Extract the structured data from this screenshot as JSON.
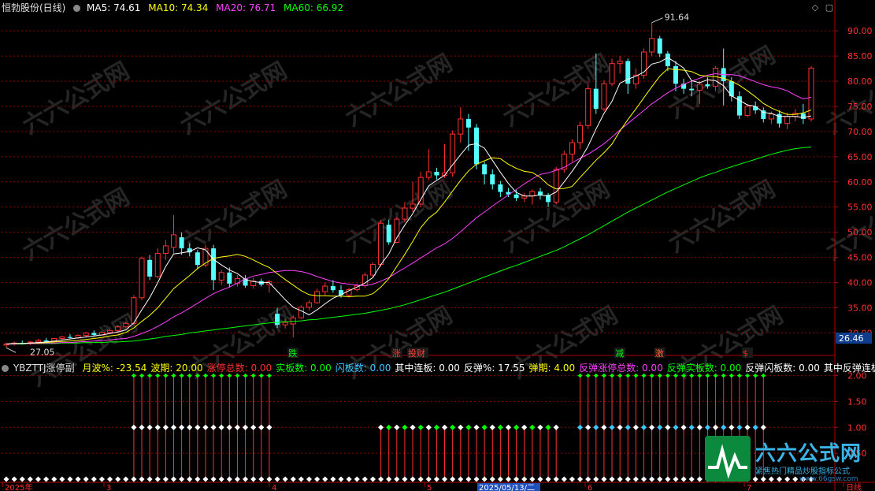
{
  "header": {
    "title": "恒勃股份(日线)",
    "ma5": "MA5: 74.61",
    "ma10": "MA10: 74.34",
    "ma20": "MA20: 76.71",
    "ma60": "MA60: 66.92"
  },
  "sub_header": {
    "name": "YBZTTJ涨停副",
    "items": [
      {
        "text": "月波%: -23.54",
        "color": "#ffff00"
      },
      {
        "text": "波期: 20.00",
        "color": "#ffff00"
      },
      {
        "text": "涨停总数: 0.00",
        "color": "#ff3030"
      },
      {
        "text": "实板数: 0.00",
        "color": "#00ff00"
      },
      {
        "text": "闪板数: 0.00",
        "color": "#3cc8ff"
      },
      {
        "text": "其中连板: 0.00",
        "color": "#ffffff"
      },
      {
        "text": "反弹%: 17.55",
        "color": "#ffffff"
      },
      {
        "text": "弹期: 4.00",
        "color": "#ffff00"
      },
      {
        "text": "反弹涨停总数: 0.00",
        "color": "#ff40ff"
      },
      {
        "text": "反弹实板数: 0.00",
        "color": "#00ff00"
      },
      {
        "text": "反弹闪板数: 0.00",
        "color": "#ffffff"
      },
      {
        "text": "其中反弹连板",
        "color": "#ffffff"
      }
    ]
  },
  "price_axis": {
    "ticks": [
      "90.00",
      "85.00",
      "80.00",
      "75.00",
      "70.00",
      "65.00",
      "60.00",
      "55.00",
      "50.00",
      "45.00",
      "40.00",
      "35.00",
      "30.00"
    ],
    "current": "26.46"
  },
  "sub_axis": {
    "ticks": [
      "2.00",
      "1.50",
      "1.00",
      "0.50"
    ]
  },
  "date_axis": {
    "labels": [
      "2025年",
      "3",
      "4",
      "5",
      "2025/05/13/二",
      "6",
      "7",
      "日线"
    ]
  },
  "annotations": {
    "high": "91.64",
    "low": "27.05",
    "events": [
      {
        "text": "跌",
        "color": "#00ff00"
      },
      {
        "text": "涨",
        "color": "#ff3030"
      },
      {
        "text": "投财",
        "color": "#ff4040"
      },
      {
        "text": "减",
        "color": "#00ff00"
      },
      {
        "text": "激",
        "color": "#ff6030"
      },
      {
        "text": "$",
        "color": "#ff2020"
      }
    ]
  },
  "logo": {
    "name": "六六公式网",
    "tagline": "紧焦热门精品炒股指标公式",
    "url": "www.66gsw.com"
  },
  "watermark": "六六公式网",
  "colors": {
    "up": "#ff3030",
    "down": "#54ffff",
    "ma5": "#ffffff",
    "ma10": "#ffff00",
    "ma20": "#ff40ff",
    "ma60": "#00ff00",
    "grid": "#8b0000"
  },
  "chart_data": {
    "type": "candlestick",
    "title": "恒勃股份(日线)",
    "ylim": [
      26,
      93
    ],
    "candles": [
      {
        "o": 27.6,
        "h": 28.1,
        "l": 27.05,
        "c": 27.8
      },
      {
        "o": 27.8,
        "h": 28.3,
        "l": 27.5,
        "c": 28.0
      },
      {
        "o": 28.0,
        "h": 28.5,
        "l": 27.7,
        "c": 27.9
      },
      {
        "o": 27.9,
        "h": 28.4,
        "l": 27.6,
        "c": 28.2
      },
      {
        "o": 28.2,
        "h": 28.8,
        "l": 28.0,
        "c": 28.5
      },
      {
        "o": 28.5,
        "h": 29.0,
        "l": 28.2,
        "c": 28.3
      },
      {
        "o": 28.3,
        "h": 29.0,
        "l": 28.1,
        "c": 28.9
      },
      {
        "o": 28.9,
        "h": 29.4,
        "l": 28.5,
        "c": 29.2
      },
      {
        "o": 29.2,
        "h": 29.8,
        "l": 28.9,
        "c": 29.0
      },
      {
        "o": 29.0,
        "h": 29.7,
        "l": 28.8,
        "c": 29.5
      },
      {
        "o": 29.5,
        "h": 30.2,
        "l": 29.2,
        "c": 30.0
      },
      {
        "o": 30.0,
        "h": 30.5,
        "l": 29.3,
        "c": 29.6
      },
      {
        "o": 29.6,
        "h": 30.3,
        "l": 29.4,
        "c": 30.1
      },
      {
        "o": 30.1,
        "h": 30.8,
        "l": 29.8,
        "c": 30.5
      },
      {
        "o": 30.5,
        "h": 31.5,
        "l": 30.2,
        "c": 31.2
      },
      {
        "o": 31.2,
        "h": 32.2,
        "l": 30.9,
        "c": 31.9
      },
      {
        "o": 31.9,
        "h": 37.5,
        "l": 31.5,
        "c": 37.0
      },
      {
        "o": 37.0,
        "h": 45.2,
        "l": 36.5,
        "c": 44.8
      },
      {
        "o": 44.5,
        "h": 45.5,
        "l": 40.5,
        "c": 41.2
      },
      {
        "o": 41.2,
        "h": 46.8,
        "l": 40.8,
        "c": 45.8
      },
      {
        "o": 45.8,
        "h": 48.5,
        "l": 44.5,
        "c": 47.3
      },
      {
        "o": 47.0,
        "h": 53.4,
        "l": 45.8,
        "c": 49.5
      },
      {
        "o": 49.0,
        "h": 50.0,
        "l": 45.5,
        "c": 46.8
      },
      {
        "o": 46.8,
        "h": 47.8,
        "l": 45.2,
        "c": 46.0
      },
      {
        "o": 46.0,
        "h": 46.5,
        "l": 42.8,
        "c": 43.5
      },
      {
        "o": 43.5,
        "h": 47.5,
        "l": 43.0,
        "c": 46.8
      },
      {
        "o": 46.8,
        "h": 47.5,
        "l": 38.5,
        "c": 40.5
      },
      {
        "o": 40.5,
        "h": 42.5,
        "l": 39.5,
        "c": 42.0
      },
      {
        "o": 42.0,
        "h": 43.0,
        "l": 39.0,
        "c": 39.8
      },
      {
        "o": 39.8,
        "h": 41.5,
        "l": 39.2,
        "c": 40.8
      },
      {
        "o": 40.8,
        "h": 41.5,
        "l": 39.0,
        "c": 39.4
      },
      {
        "o": 39.4,
        "h": 41.0,
        "l": 38.8,
        "c": 40.3
      },
      {
        "o": 40.3,
        "h": 40.8,
        "l": 39.2,
        "c": 39.6
      },
      {
        "o": 39.6,
        "h": 40.5,
        "l": 38.0,
        "c": 40.2
      },
      {
        "o": 33.8,
        "h": 35.0,
        "l": 31.0,
        "c": 31.6
      },
      {
        "o": 31.6,
        "h": 32.8,
        "l": 30.9,
        "c": 32.1
      },
      {
        "o": 31.8,
        "h": 33.5,
        "l": 29.1,
        "c": 33.0
      },
      {
        "o": 33.0,
        "h": 35.5,
        "l": 32.8,
        "c": 35.1
      },
      {
        "o": 35.1,
        "h": 36.5,
        "l": 34.5,
        "c": 36.0
      },
      {
        "o": 36.0,
        "h": 38.8,
        "l": 35.8,
        "c": 38.2
      },
      {
        "o": 38.2,
        "h": 40.0,
        "l": 37.5,
        "c": 39.3
      },
      {
        "o": 39.3,
        "h": 40.5,
        "l": 38.0,
        "c": 38.5
      },
      {
        "o": 38.5,
        "h": 39.5,
        "l": 37.0,
        "c": 37.5
      },
      {
        "o": 37.5,
        "h": 39.0,
        "l": 37.0,
        "c": 38.6
      },
      {
        "o": 38.6,
        "h": 39.8,
        "l": 38.2,
        "c": 39.4
      },
      {
        "o": 39.4,
        "h": 42.0,
        "l": 39.0,
        "c": 41.5
      },
      {
        "o": 41.5,
        "h": 44.0,
        "l": 41.0,
        "c": 43.6
      },
      {
        "o": 43.6,
        "h": 52.4,
        "l": 43.2,
        "c": 51.8
      },
      {
        "o": 51.5,
        "h": 52.5,
        "l": 47.5,
        "c": 48.0
      },
      {
        "o": 48.0,
        "h": 53.0,
        "l": 47.8,
        "c": 52.6
      },
      {
        "o": 52.6,
        "h": 56.0,
        "l": 52.0,
        "c": 54.8
      },
      {
        "o": 54.8,
        "h": 60.0,
        "l": 54.0,
        "c": 55.6
      },
      {
        "o": 55.6,
        "h": 62.0,
        "l": 55.0,
        "c": 60.9
      },
      {
        "o": 60.9,
        "h": 66.5,
        "l": 60.3,
        "c": 62.0
      },
      {
        "o": 62.0,
        "h": 62.8,
        "l": 60.5,
        "c": 61.3
      },
      {
        "o": 61.3,
        "h": 67.5,
        "l": 60.8,
        "c": 61.8
      },
      {
        "o": 61.8,
        "h": 70.2,
        "l": 61.0,
        "c": 69.5
      },
      {
        "o": 69.5,
        "h": 74.8,
        "l": 67.8,
        "c": 72.5
      },
      {
        "o": 72.5,
        "h": 73.5,
        "l": 66.2,
        "c": 70.8
      },
      {
        "o": 70.8,
        "h": 71.5,
        "l": 62.5,
        "c": 63.5
      },
      {
        "o": 63.5,
        "h": 64.0,
        "l": 59.5,
        "c": 61.5
      },
      {
        "o": 61.5,
        "h": 62.5,
        "l": 58.5,
        "c": 59.5
      },
      {
        "o": 59.5,
        "h": 60.2,
        "l": 57.0,
        "c": 58.0
      },
      {
        "o": 58.0,
        "h": 58.8,
        "l": 57.0,
        "c": 57.5
      },
      {
        "o": 57.5,
        "h": 58.5,
        "l": 56.2,
        "c": 56.8
      },
      {
        "o": 56.8,
        "h": 57.8,
        "l": 56.0,
        "c": 57.2
      },
      {
        "o": 57.2,
        "h": 58.5,
        "l": 55.5,
        "c": 58.1
      },
      {
        "o": 58.1,
        "h": 58.8,
        "l": 56.5,
        "c": 57.4
      },
      {
        "o": 57.4,
        "h": 57.8,
        "l": 55.0,
        "c": 56.0
      },
      {
        "o": 56.0,
        "h": 63.0,
        "l": 55.5,
        "c": 62.5
      },
      {
        "o": 62.5,
        "h": 66.2,
        "l": 61.8,
        "c": 65.5
      },
      {
        "o": 65.5,
        "h": 68.5,
        "l": 64.0,
        "c": 67.8
      },
      {
        "o": 67.8,
        "h": 72.0,
        "l": 66.5,
        "c": 71.2
      },
      {
        "o": 71.2,
        "h": 79.5,
        "l": 70.5,
        "c": 78.5
      },
      {
        "o": 78.5,
        "h": 85.5,
        "l": 73.5,
        "c": 74.5
      },
      {
        "o": 74.5,
        "h": 80.2,
        "l": 74.0,
        "c": 79.5
      },
      {
        "o": 79.5,
        "h": 84.5,
        "l": 79.0,
        "c": 83.5
      },
      {
        "o": 83.5,
        "h": 85.0,
        "l": 81.5,
        "c": 84.0
      },
      {
        "o": 84.0,
        "h": 84.5,
        "l": 77.5,
        "c": 79.5
      },
      {
        "o": 79.5,
        "h": 82.5,
        "l": 78.5,
        "c": 81.2
      },
      {
        "o": 81.2,
        "h": 86.5,
        "l": 80.5,
        "c": 85.8
      },
      {
        "o": 85.8,
        "h": 91.64,
        "l": 85.0,
        "c": 88.5
      },
      {
        "o": 88.5,
        "h": 89.0,
        "l": 84.8,
        "c": 85.5
      },
      {
        "o": 85.5,
        "h": 86.0,
        "l": 82.0,
        "c": 83.0
      },
      {
        "o": 83.0,
        "h": 84.0,
        "l": 78.0,
        "c": 79.5
      },
      {
        "o": 79.5,
        "h": 80.5,
        "l": 77.5,
        "c": 78.5
      },
      {
        "o": 78.5,
        "h": 80.0,
        "l": 77.0,
        "c": 78.2
      },
      {
        "o": 78.2,
        "h": 80.0,
        "l": 75.5,
        "c": 79.4
      },
      {
        "o": 79.4,
        "h": 80.8,
        "l": 78.5,
        "c": 79.0
      },
      {
        "o": 79.0,
        "h": 83.0,
        "l": 78.0,
        "c": 82.6
      },
      {
        "o": 82.6,
        "h": 86.5,
        "l": 75.2,
        "c": 80.0
      },
      {
        "o": 80.0,
        "h": 80.8,
        "l": 76.0,
        "c": 77.0
      },
      {
        "o": 77.0,
        "h": 78.0,
        "l": 72.5,
        "c": 73.2
      },
      {
        "o": 73.2,
        "h": 75.5,
        "l": 72.8,
        "c": 75.0
      },
      {
        "o": 75.0,
        "h": 76.0,
        "l": 73.5,
        "c": 74.2
      },
      {
        "o": 74.2,
        "h": 74.8,
        "l": 71.8,
        "c": 72.5
      },
      {
        "o": 72.5,
        "h": 74.0,
        "l": 71.5,
        "c": 73.5
      },
      {
        "o": 73.5,
        "h": 74.2,
        "l": 70.8,
        "c": 71.6
      },
      {
        "o": 71.6,
        "h": 73.8,
        "l": 70.5,
        "c": 73.0
      },
      {
        "o": 73.0,
        "h": 74.5,
        "l": 72.0,
        "c": 73.6
      },
      {
        "o": 73.6,
        "h": 75.5,
        "l": 71.5,
        "c": 72.5
      },
      {
        "o": 72.5,
        "h": 83.0,
        "l": 72.0,
        "c": 82.6
      }
    ],
    "ma5": [
      27.8,
      27.9,
      27.9,
      28.0,
      28.1,
      28.2,
      28.4,
      28.6,
      28.8,
      29.0,
      29.2,
      29.4,
      29.6,
      29.9,
      30.2,
      30.6,
      32.0,
      34.6,
      37.0,
      40.0,
      43.2,
      45.7,
      45.9,
      46.2,
      46.9,
      46.5,
      44.6,
      43.5,
      42.5,
      41.8,
      40.6,
      40.2,
      40.0,
      40.0,
      38.3,
      36.6,
      35.1,
      34.4,
      33.6,
      34.6,
      35.8,
      36.9,
      37.6,
      38.4,
      39.1,
      39.9,
      41.0,
      43.6,
      45.7,
      48.9,
      51.4,
      53.7,
      56.5,
      59.2,
      60.3,
      61.3,
      63.4,
      65.4,
      67.3,
      67.6,
      66.7,
      64.3,
      61.9,
      59.7,
      57.9,
      57.2,
      57.2,
      57.4,
      57.2,
      58.0,
      60.0,
      62.1,
      64.4,
      67.1,
      70.5,
      73.6,
      76.0,
      79.6,
      80.4,
      81.0,
      81.8,
      83.4,
      83.8,
      84.7,
      83.7,
      82.6,
      80.1,
      79.7,
      80.3,
      80.1,
      79.1,
      77.1,
      76.2,
      75.3,
      75.0,
      73.8,
      73.6,
      73.0,
      73.0,
      73.0,
      72.8,
      73.1
    ],
    "ma10": [
      27.8,
      27.9,
      27.9,
      28.0,
      28.0,
      28.1,
      28.2,
      28.3,
      28.4,
      28.5,
      28.7,
      28.9,
      29.1,
      29.4,
      29.6,
      30.1,
      31.0,
      32.3,
      33.5,
      35.0,
      36.9,
      38.8,
      40.1,
      41.4,
      42.8,
      43.9,
      44.8,
      45.1,
      45.3,
      45.6,
      45.2,
      44.5,
      43.7,
      43.0,
      41.8,
      40.6,
      39.5,
      38.4,
      37.6,
      37.4,
      37.4,
      37.3,
      37.3,
      37.2,
      37.3,
      37.3,
      37.8,
      39.1,
      40.8,
      43.2,
      45.6,
      48.2,
      50.9,
      52.8,
      54.0,
      56.0,
      58.2,
      60.3,
      62.2,
      63.5,
      64.2,
      64.8,
      64.6,
      63.5,
      62.7,
      62.1,
      61.9,
      60.9,
      59.4,
      58.6,
      58.7,
      59.1,
      60.9,
      62.6,
      64.3,
      65.8,
      67.5,
      70.1,
      72.4,
      74.5,
      76.7,
      78.9,
      81.0,
      82.5,
      82.3,
      82.2,
      81.9,
      81.2,
      81.0,
      80.9,
      80.6,
      80.0,
      79.2,
      78.1,
      76.9,
      75.6,
      74.7,
      74.0,
      73.4,
      73.4,
      73.7,
      74.3
    ],
    "ma20": [
      27.8,
      27.8,
      27.9,
      27.9,
      27.9,
      28.0,
      28.0,
      28.1,
      28.1,
      28.2,
      28.3,
      28.4,
      28.5,
      28.6,
      28.8,
      28.9,
      29.3,
      29.9,
      30.5,
      31.3,
      32.2,
      33.2,
      34.0,
      34.9,
      35.9,
      36.9,
      37.8,
      38.5,
      39.1,
      39.9,
      40.7,
      41.3,
      41.6,
      42.0,
      42.2,
      42.4,
      42.4,
      42.2,
      41.8,
      41.2,
      40.7,
      40.2,
      39.9,
      39.7,
      39.5,
      39.4,
      39.7,
      40.3,
      41.0,
      42.0,
      42.9,
      43.9,
      44.9,
      45.9,
      46.9,
      47.7,
      48.8,
      50.1,
      51.5,
      52.9,
      54.0,
      55.2,
      56.3,
      57.4,
      58.5,
      59.6,
      60.6,
      61.5,
      61.8,
      62.3,
      62.9,
      63.8,
      64.7,
      65.5,
      66.5,
      67.6,
      68.9,
      70.3,
      71.6,
      72.9,
      74.2,
      75.5,
      76.6,
      77.7,
      78.6,
      79.4,
      80.0,
      80.6,
      81.2,
      81.5,
      81.3,
      81.3,
      81.1,
      80.5,
      79.9,
      79.3,
      78.9,
      78.6,
      78.1,
      77.2,
      76.5,
      76.8
    ],
    "ma60": [
      27.8,
      27.8,
      27.8,
      27.9,
      27.9,
      27.9,
      27.9,
      28.0,
      28.0,
      28.0,
      28.1,
      28.1,
      28.1,
      28.2,
      28.2,
      28.3,
      28.4,
      28.6,
      28.8,
      29.0,
      29.3,
      29.5,
      29.7,
      30.0,
      30.2,
      30.4,
      30.6,
      30.8,
      31.0,
      31.2,
      31.4,
      31.6,
      31.8,
      32.0,
      32.1,
      32.2,
      32.3,
      32.4,
      32.6,
      32.7,
      32.9,
      33.1,
      33.3,
      33.5,
      33.7,
      33.9,
      34.2,
      34.5,
      34.8,
      35.2,
      35.6,
      36.1,
      36.6,
      37.1,
      37.6,
      38.1,
      38.7,
      39.3,
      39.9,
      40.5,
      41.1,
      41.7,
      42.3,
      42.9,
      43.4,
      44.0,
      44.6,
      45.2,
      45.8,
      46.4,
      47.1,
      47.9,
      48.7,
      49.5,
      50.4,
      51.3,
      52.2,
      53.1,
      54.0,
      54.8,
      55.6,
      56.4,
      57.2,
      58.0,
      58.7,
      59.4,
      60.1,
      60.8,
      61.4,
      61.9,
      62.5,
      63.0,
      63.5,
      64.0,
      64.5,
      65.0,
      65.5,
      65.9,
      66.3,
      66.6,
      66.8,
      66.92
    ]
  }
}
